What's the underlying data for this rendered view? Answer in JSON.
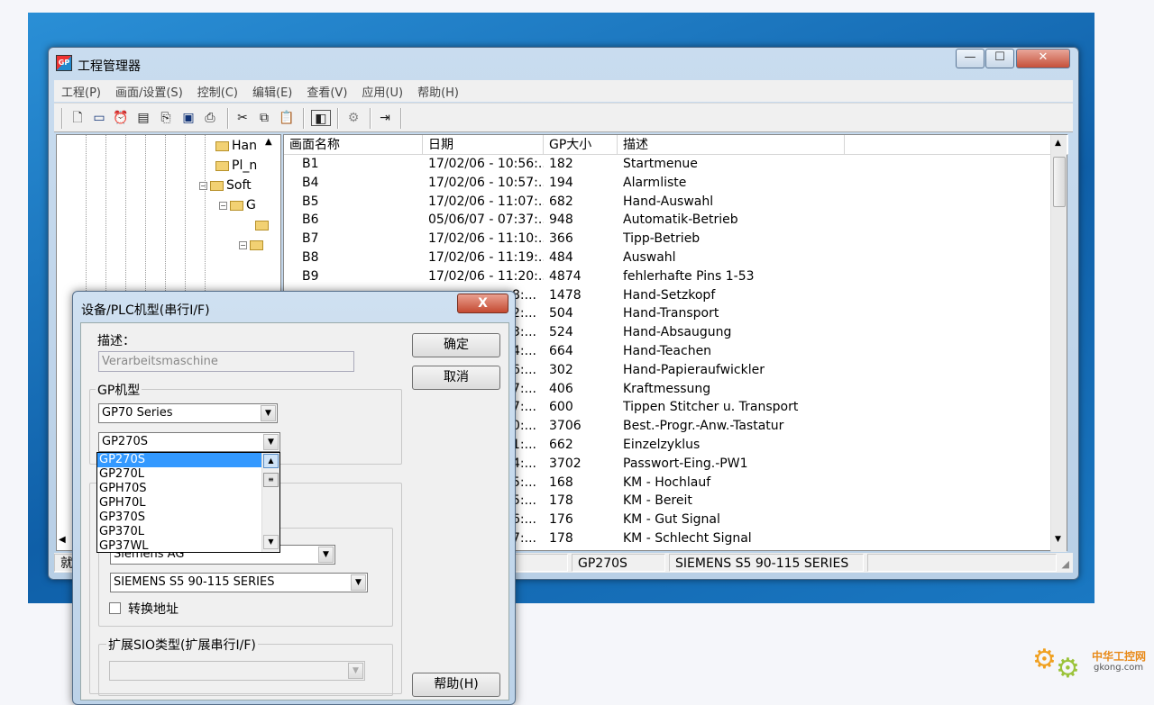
{
  "main_window": {
    "title": "工程管理器",
    "app_icon": "GP",
    "menu": [
      "工程(P)",
      "画面/设置(S)",
      "控制(C)",
      "编辑(E)",
      "查看(V)",
      "应用(U)",
      "帮助(H)"
    ],
    "caption_buttons": {
      "minimize": "—",
      "maximize": "☐",
      "close": "✕"
    }
  },
  "tree": {
    "items": [
      {
        "label": "Han",
        "icon": "folder-icon"
      },
      {
        "label": "Pl_n",
        "icon": "folder-icon"
      },
      {
        "label": "Soft",
        "icon": "folder-icon",
        "expanded": true
      },
      {
        "label": "G",
        "icon": "folder-icon",
        "expanded": true
      }
    ]
  },
  "list": {
    "headers": [
      "画面名称",
      "日期",
      "GP大小",
      "描述"
    ],
    "rows": [
      {
        "name": "B1",
        "date": "17/02/06 - 10:56:...",
        "size": "182",
        "desc": "Startmenue"
      },
      {
        "name": "B4",
        "date": "17/02/06 - 10:57:...",
        "size": "194",
        "desc": "Alarmliste"
      },
      {
        "name": "B5",
        "date": "17/02/06 - 11:07:...",
        "size": "682",
        "desc": "Hand-Auswahl"
      },
      {
        "name": "B6",
        "date": "05/06/07 - 07:37:...",
        "size": "948",
        "desc": "Automatik-Betrieb"
      },
      {
        "name": "B7",
        "date": "17/02/06 - 11:10:...",
        "size": "366",
        "desc": "Tipp-Betrieb"
      },
      {
        "name": "B8",
        "date": "17/02/06 - 11:19:...",
        "size": "484",
        "desc": "Auswahl"
      },
      {
        "name": "B9",
        "date": "17/02/06 - 11:20:...",
        "size": "4874",
        "desc": "fehlerhafte Pins 1-53"
      },
      {
        "name": "",
        "date": "8:...",
        "size": "1478",
        "desc": "Hand-Setzkopf"
      },
      {
        "name": "",
        "date": "2:...",
        "size": "504",
        "desc": "Hand-Transport"
      },
      {
        "name": "",
        "date": "3:...",
        "size": "524",
        "desc": "Hand-Absaugung"
      },
      {
        "name": "",
        "date": "4:...",
        "size": "664",
        "desc": "Hand-Teachen"
      },
      {
        "name": "",
        "date": "6:...",
        "size": "302",
        "desc": "Hand-Papieraufwickler"
      },
      {
        "name": "",
        "date": "7:...",
        "size": "406",
        "desc": "Kraftmessung"
      },
      {
        "name": "",
        "date": "7:...",
        "size": "600",
        "desc": "Tippen Stitcher u. Transport"
      },
      {
        "name": "",
        "date": "0:...",
        "size": "3706",
        "desc": "Best.-Progr.-Anw.-Tastatur"
      },
      {
        "name": "",
        "date": "1:...",
        "size": "662",
        "desc": "Einzelzyklus"
      },
      {
        "name": "",
        "date": "4:...",
        "size": "3702",
        "desc": "Passwort-Eing.-PW1"
      },
      {
        "name": "",
        "date": "5:...",
        "size": "168",
        "desc": "KM - Hochlauf"
      },
      {
        "name": "",
        "date": "5:...",
        "size": "178",
        "desc": "KM - Bereit"
      },
      {
        "name": "",
        "date": "6:...",
        "size": "176",
        "desc": "KM - Gut Signal"
      },
      {
        "name": "",
        "date": "7:...",
        "size": "178",
        "desc": "KM - Schlecht Signal"
      }
    ]
  },
  "statusbar": {
    "ready": "就绪",
    "model": "GP270S",
    "plc": "SIEMENS S5 90-115 SERIES"
  },
  "dialog": {
    "title": "设备/PLC机型(串行I/F)",
    "close": "X",
    "desc_label": "描述：",
    "desc_value": "Verarbeitsmaschine",
    "ok": "确定",
    "cancel": "取消",
    "help": "帮助(H)",
    "gp_group": "GP机型",
    "series": "GP70 Series",
    "model": "GP270S",
    "model_options": [
      "GP270S",
      "GP270L",
      "GPH70S",
      "GPH70L",
      "GP370S",
      "GP370L",
      "GP37WL"
    ],
    "maker": "Siemens AG",
    "plc_series": "SIEMENS S5 90-115 SERIES",
    "convert_addr": "转换地址",
    "ext_sio": "扩展SIO类型(扩展串行I/F)"
  },
  "watermark": {
    "brand": "中华工控网",
    "domain": "gkong.com"
  }
}
